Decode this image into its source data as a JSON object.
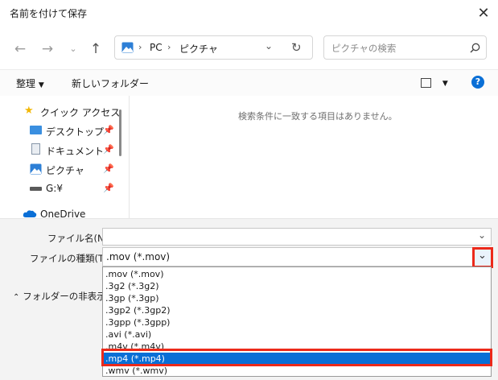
{
  "window": {
    "title": "名前を付けて保存"
  },
  "address": {
    "segments": [
      "PC",
      "ピクチャ"
    ]
  },
  "search": {
    "placeholder": "ピクチャの検索"
  },
  "toolbar": {
    "organize": "整理",
    "new_folder": "新しいフォルダー"
  },
  "nav": {
    "items": [
      {
        "label": "クイック アクセス",
        "icon": "star-icon"
      },
      {
        "label": "デスクトップ",
        "icon": "desktop-icon"
      },
      {
        "label": "ドキュメント",
        "icon": "document-icon"
      },
      {
        "label": "ピクチャ",
        "icon": "pictures-icon"
      },
      {
        "label": "G:¥",
        "icon": "drive-icon"
      },
      {
        "label": "OneDrive",
        "icon": "cloud-icon"
      }
    ]
  },
  "content": {
    "empty_message": "検索条件に一致する項目はありません。"
  },
  "form": {
    "filename_label": "ファイル名(N):",
    "filename_value": "",
    "filetype_label": "ファイルの種類(T):",
    "filetype_value": ".mov (*.mov)",
    "hide_folders": "フォルダーの非表示",
    "filetype_options": [
      ".mov (*.mov)",
      ".3g2 (*.3g2)",
      ".3gp (*.3gp)",
      ".3gp2 (*.3gp2)",
      ".3gpp (*.3gpp)",
      ".avi (*.avi)",
      ".m4v (*.m4v)",
      ".mp4 (*.mp4)",
      ".wmv (*.wmv)"
    ],
    "selected_option": ".mp4 (*.mp4)"
  },
  "colors": {
    "accent": "#0a6fd6",
    "highlight": "#ec2a1b",
    "help": "#0a6fd6"
  }
}
